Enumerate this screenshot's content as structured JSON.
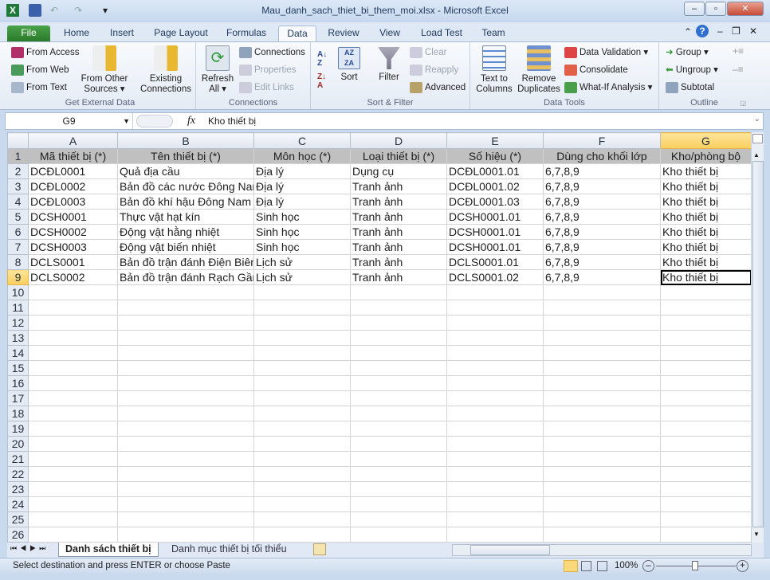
{
  "window": {
    "title": "Mau_danh_sach_thiet_bi_them_moi.xlsx - Microsoft Excel"
  },
  "tabs": [
    "File",
    "Home",
    "Insert",
    "Page Layout",
    "Formulas",
    "Data",
    "Review",
    "View",
    "Load Test",
    "Team"
  ],
  "active_tab": "Data",
  "ribbon": {
    "get_external": {
      "label": "Get External Data",
      "from_access": "From Access",
      "from_web": "From Web",
      "from_text": "From Text",
      "from_other": "From Other",
      "from_other2": "Sources ▾",
      "existing": "Existing",
      "existing2": "Connections"
    },
    "connections": {
      "label": "Connections",
      "refresh": "Refresh",
      "refresh2": "All ▾",
      "connections": "Connections",
      "properties": "Properties",
      "edit_links": "Edit Links"
    },
    "sort_filter": {
      "label": "Sort & Filter",
      "sort": "Sort",
      "filter": "Filter",
      "clear": "Clear",
      "reapply": "Reapply",
      "advanced": "Advanced"
    },
    "data_tools": {
      "label": "Data Tools",
      "text_to": "Text to",
      "columns": "Columns",
      "remove": "Remove",
      "duplicates": "Duplicates",
      "validation": "Data Validation ▾",
      "consolidate": "Consolidate",
      "whatif": "What-If Analysis ▾"
    },
    "outline": {
      "label": "Outline",
      "group": "Group ▾",
      "ungroup": "Ungroup ▾",
      "subtotal": "Subtotal"
    }
  },
  "formula_bar": {
    "name_box": "G9",
    "fx": "fx",
    "value": "Kho thiết bị"
  },
  "sheet": {
    "columns": [
      "A",
      "B",
      "C",
      "D",
      "E",
      "F",
      "G"
    ],
    "selected_column": "G",
    "selected_row": 9,
    "header_row": [
      "Mã thiết bị (*)",
      "Tên thiết bị (*)",
      "Môn học (*)",
      "Loại thiết bị (*)",
      "Số hiệu (*)",
      "Dùng cho khối lớp",
      "Kho/phòng bộ"
    ],
    "rows": [
      [
        "DCĐL0001",
        "Quả địa cầu",
        "Địa lý",
        "Dụng cụ",
        "DCĐL0001.01",
        "6,7,8,9",
        "Kho thiết bị"
      ],
      [
        "DCĐL0002",
        "Bản đồ các nước Đông Nam Á",
        "Địa lý",
        "Tranh ảnh",
        "DCĐL0001.02",
        "6,7,8,9",
        "Kho thiết bị"
      ],
      [
        "DCĐL0003",
        "Bản đồ khí hậu Đông Nam Á",
        "Địa lý",
        "Tranh ảnh",
        "DCĐL0001.03",
        "6,7,8,9",
        "Kho thiết bị"
      ],
      [
        "DCSH0001",
        "Thực vật hạt kín",
        "Sinh học",
        "Tranh ảnh",
        "DCSH0001.01",
        "6,7,8,9",
        "Kho thiết bị"
      ],
      [
        "DCSH0002",
        "Động vật hằng nhiệt",
        "Sinh học",
        "Tranh ảnh",
        "DCSH0001.01",
        "6,7,8,9",
        "Kho thiết bị"
      ],
      [
        "DCSH0003",
        "Động vật biến nhiệt",
        "Sinh học",
        "Tranh ảnh",
        "DCSH0001.01",
        "6,7,8,9",
        "Kho thiết bị"
      ],
      [
        "DCLS0001",
        "Bản đồ trận đánh Điện Biên Phủ",
        "Lịch sử",
        "Tranh ảnh",
        "DCLS0001.01",
        "6,7,8,9",
        "Kho thiết bị"
      ],
      [
        "DCLS0002",
        "Bản đồ trận đánh Rạch Gầm",
        "Lịch sử",
        "Tranh ảnh",
        "DCLS0001.02",
        "6,7,8,9",
        "Kho thiết bị"
      ]
    ],
    "row_count": 26
  },
  "sheet_tabs": [
    "Danh sách thiết bị",
    "Danh mục thiết bị tối thiểu"
  ],
  "status": {
    "message": "Select destination and press ENTER or choose Paste",
    "zoom": "100%"
  }
}
